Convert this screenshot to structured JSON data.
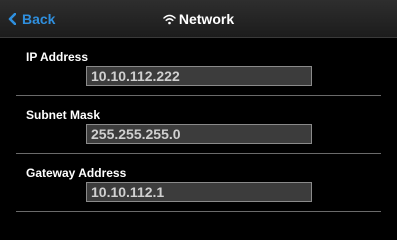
{
  "header": {
    "back_label": "Back",
    "title": "Network",
    "accent_color": "#2f8fde",
    "title_icon": "wifi-icon",
    "back_icon": "chevron-left-icon"
  },
  "fields": {
    "ip": {
      "label": "IP Address",
      "value": "10.10.112.222"
    },
    "subnet": {
      "label": "Subnet Mask",
      "value": "255.255.255.0"
    },
    "gateway": {
      "label": "Gateway Address",
      "value": "10.10.112.1"
    }
  }
}
